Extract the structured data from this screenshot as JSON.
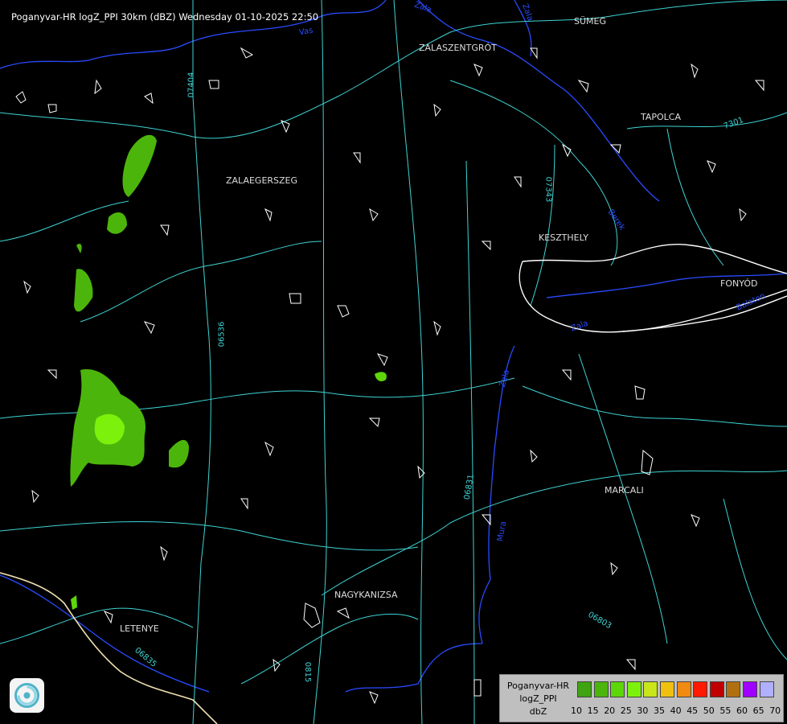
{
  "title": "Poganyvar-HR logZ_PPI 30km (dBZ) Wednesday 01-10-2025 22:50",
  "cities": [
    "SÜMEG",
    "ZALASZENTGRÓT",
    "TAPOLCA",
    "ZALAEGERSZEG",
    "KESZTHELY",
    "FONYÓD",
    "MARCALI",
    "NAGYKANIZSA",
    "LETENYE"
  ],
  "road_labels": [
    "07404",
    "07343",
    "7301",
    "06536",
    "06831",
    "06803",
    "06835",
    "0815"
  ],
  "river_labels": [
    "Zala",
    "Zala",
    "Berek",
    "Zala",
    "Balaton",
    "Vas",
    "Zala",
    "Mura"
  ],
  "legend": {
    "line1": "Poganyvar-HR",
    "line2": "logZ_PPI",
    "line3": "dbZ",
    "values": [
      "10",
      "15",
      "20",
      "25",
      "30",
      "35",
      "40",
      "45",
      "50",
      "55",
      "60",
      "65",
      "70"
    ],
    "colors": [
      "#3fa312",
      "#4cb50c",
      "#5dd60a",
      "#7cf20c",
      "#c8e61a",
      "#f0c010",
      "#f08a10",
      "#ff1a00",
      "#c00000",
      "#b07010",
      "#a000ff",
      "#b0b0ff"
    ]
  },
  "colors": {
    "roads": "#3fd3d3",
    "rivers": "#2a4bff",
    "borders": "#ffffff",
    "echo": "#5bc81a"
  }
}
